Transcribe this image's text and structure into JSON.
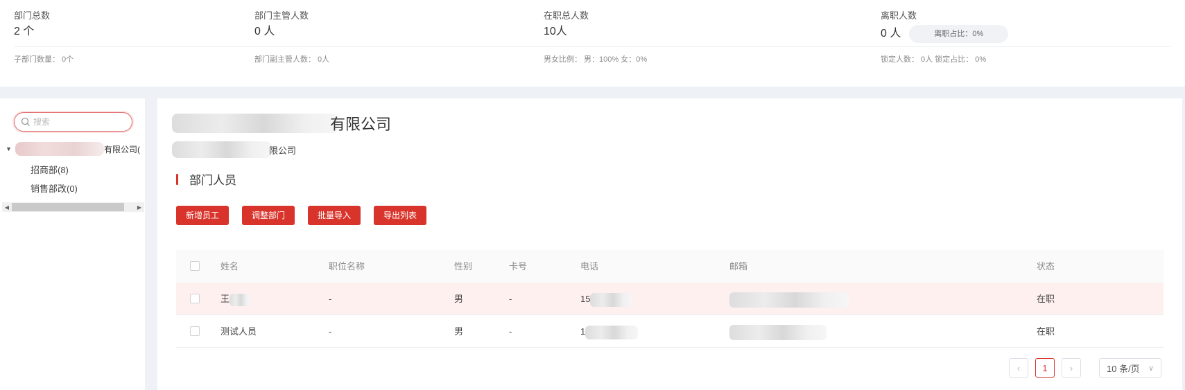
{
  "stats": {
    "items": [
      {
        "label": "部门总数",
        "value": "2 个"
      },
      {
        "label": "部门主管人数",
        "value": "0 人"
      },
      {
        "label": "在职总人数",
        "value": "10人"
      },
      {
        "label": "离职人数",
        "value": "0 人"
      }
    ],
    "leave_ratio_pill": "离职占比：0%",
    "sub": [
      "子部门数量：  0个",
      "部门副主管人数：  0人",
      "男女比例：  男：100%  女：0%",
      "锁定人数：  0人   锁定占比：   0%"
    ]
  },
  "sidebar": {
    "search_placeholder": "搜索",
    "root_label": "有限公司(",
    "children": [
      "招商部(8)",
      "销售部改(0)"
    ]
  },
  "main": {
    "company_title": "有限公司",
    "company_sub": "限公司",
    "section_title": "部门人员",
    "buttons": {
      "add": "新增员工",
      "adjust": "调整部门",
      "import": "批量导入",
      "export": "导出列表"
    },
    "table": {
      "headers": [
        "姓名",
        "职位名称",
        "性别",
        "卡号",
        "电话",
        "邮箱",
        "状态"
      ],
      "rows": [
        {
          "name": "王",
          "position": "-",
          "gender": "男",
          "card": "-",
          "phone": "15",
          "status": "在职"
        },
        {
          "name": "测试人员",
          "position": "-",
          "gender": "男",
          "card": "-",
          "phone": "1",
          "status": "在职"
        }
      ]
    },
    "pagination": {
      "prev": "‹",
      "current": "1",
      "next": "›",
      "page_size": "10 条/页"
    }
  },
  "colors": {
    "accent": "#d9342b",
    "row_highlight": "#fdf0ef"
  }
}
